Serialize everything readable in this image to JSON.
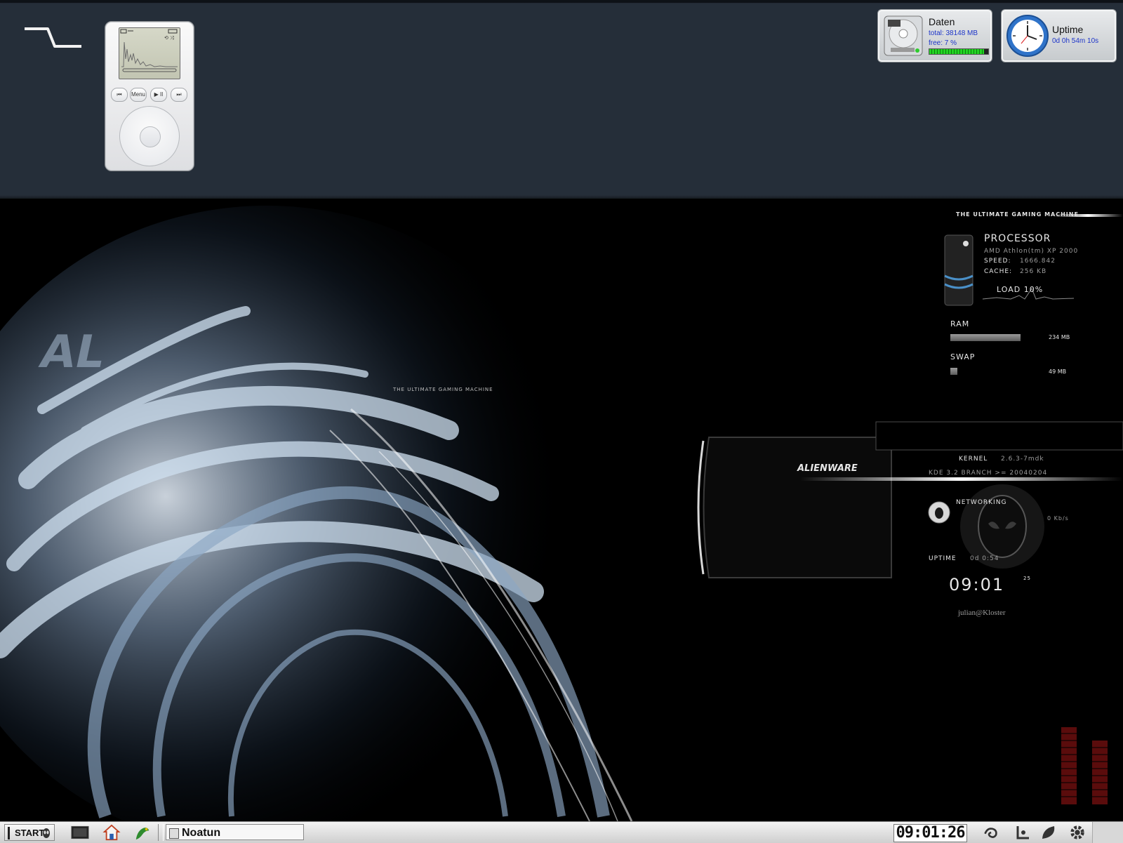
{
  "disk_applet": {
    "title": "Daten",
    "total": "total: 38148 MB",
    "free": "free: 7 %",
    "usage_percent": 93
  },
  "uptime_applet": {
    "title": "Uptime",
    "value": "0d 0h 54m 10s"
  },
  "ipod": {
    "buttons": [
      "⏮",
      "Menu",
      "▶ II",
      "⏭"
    ]
  },
  "theme": {
    "tagline_top": "THE ULTIMATE GAMING MACHINE",
    "tagline_mid": "THE ULTIMATE GAMING MACHINE",
    "processor_title": "PROCESSOR",
    "cpu_model": "AMD Athlon(tm) XP 2000",
    "speed_label": "SPEED:",
    "speed_value": "1666.842",
    "cache_label": "CACHE:",
    "cache_value": "256 KB",
    "load": "LOAD 10%",
    "ram_label": "RAM",
    "ram_value": "234 MB",
    "ram_fill": 0.78,
    "swap_label": "SWAP",
    "swap_value": "49 MB",
    "swap_fill": 0.08,
    "kernel_label": "KERNEL",
    "kernel_value": "2.6.3-7mdk",
    "kde_line": "KDE 3.2 BRANCH >= 20040204",
    "networking_label": "NETWORKING",
    "net_speed": "0 Kb/s",
    "uptime_label": "UPTIME",
    "uptime_value": "0d 0:54",
    "time": "09:01",
    "seconds": "25",
    "user": "julian@Kloster",
    "brand": "ALIENWARE"
  },
  "taskbar": {
    "start_label": "START",
    "task_label": "Noatun",
    "clock": "09:01:26"
  },
  "colors": {
    "top_panel": "#252e39",
    "meter_red": "#7a1010",
    "disk_bar_green": "#1fd41f"
  }
}
